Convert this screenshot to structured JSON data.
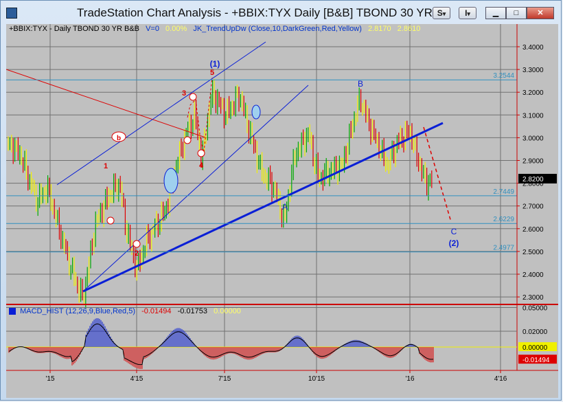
{
  "window": {
    "title": "TradeStation Chart Analysis - +BBIX:TYX Daily [B&B] TBOND 30 YR",
    "btn_s": "S",
    "btn_i": "I",
    "btn_min": "▁",
    "btn_max": "□",
    "btn_close": "✕",
    "dropdown_arrow": "▾"
  },
  "header": {
    "symbol": "+BBIX:TYX - Daily  TBOND 30 YR  B&B",
    "v": "V=0",
    "pct": "0.00%",
    "indicator": "JK_TrendUpDw (Close,10,DarkGreen,Red,Yellow)",
    "val1": "2.8170",
    "val2": "2.8610"
  },
  "macd_header": {
    "label": "MACD_HIST (12,26,9,Blue,Red,5)",
    "v1": "-0.01494",
    "v2": "-0.01753",
    "v3": "0.00000"
  },
  "colors": {
    "background": "#c0c0c0",
    "grid": "#707070",
    "up": "#00aa00",
    "down": "#dd0000",
    "neutral": "#f0f000",
    "trend": "#0a1fd6",
    "axis": "#cc0000",
    "level": "#2f8fbf"
  },
  "chart_data": {
    "type": "candlestick",
    "x_ticks": [
      "'15",
      "4'15",
      "7'15",
      "10'15",
      "'16",
      "4'16"
    ],
    "price_axis": [
      "3.4000",
      "3.3000",
      "3.2000",
      "3.1000",
      "3.0000",
      "2.9000",
      "2.8000",
      "2.7000",
      "2.6000",
      "2.5000",
      "2.4000",
      "2.3000"
    ],
    "last_price": "2.8200",
    "levels": [
      "3.2544",
      "2.7449",
      "2.6229",
      "2.4977"
    ],
    "wave_labels": [
      "(1)",
      "5",
      "3",
      "b",
      "4",
      "1",
      "a",
      "2",
      "A",
      "B",
      "C",
      "(2)"
    ],
    "macd_axis": [
      "0.05000",
      "0.02000",
      "0.00000",
      "-0.01494"
    ]
  }
}
